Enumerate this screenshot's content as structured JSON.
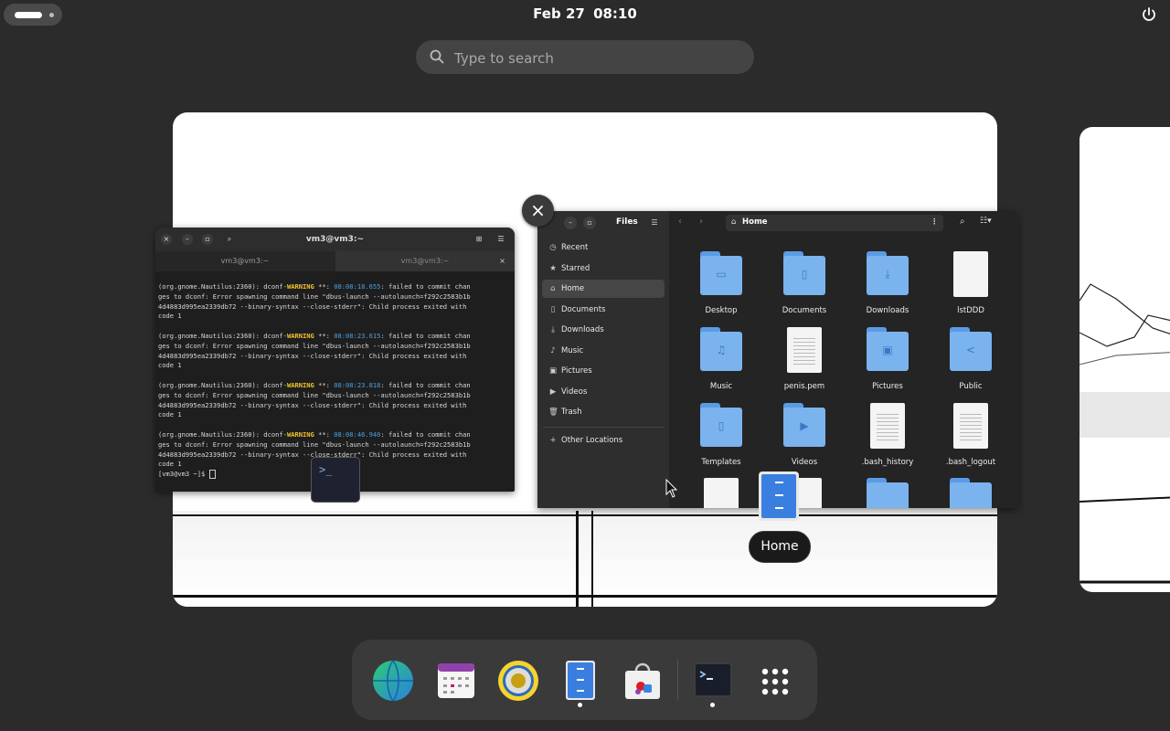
{
  "topbar": {
    "date": "Feb 27",
    "time": "08:10"
  },
  "search": {
    "placeholder": "Type to search"
  },
  "terminal": {
    "title": "vm3@vm3:~",
    "tabs": [
      "vm3@vm3:~",
      "vm3@vm3:~"
    ],
    "close_tab": "×",
    "log_entries": [
      {
        "prefix": "(org.gnome.Nautilus:2360): dconf-",
        "level": "WARNING",
        "mid": " **: ",
        "time": "08:08:18.655",
        "msg": ": failed to commit chan",
        "rest": [
          "ges to dconf: Error spawning command line \"dbus-launch --autolaunch=f292c2583b1b",
          "4d4883d995ea2339db72 --binary-syntax --close-stderr\": Child process exited with",
          "code 1"
        ]
      },
      {
        "prefix": "(org.gnome.Nautilus:2360): dconf-",
        "level": "WARNING",
        "mid": " **: ",
        "time": "08:08:23.615",
        "msg": ": failed to commit chan",
        "rest": [
          "ges to dconf: Error spawning command line \"dbus-launch --autolaunch=f292c2583b1b",
          "4d4883d995ea2339db72 --binary-syntax --close-stderr\": Child process exited with",
          "code 1"
        ]
      },
      {
        "prefix": "(org.gnome.Nautilus:2360): dconf-",
        "level": "WARNING",
        "mid": " **: ",
        "time": "08:08:23.818",
        "msg": ": failed to commit chan",
        "rest": [
          "ges to dconf: Error spawning command line \"dbus-launch --autolaunch=f292c2583b1b",
          "4d4883d995ea2339db72 --binary-syntax --close-stderr\": Child process exited with",
          "code 1"
        ]
      },
      {
        "prefix": "(org.gnome.Nautilus:2360): dconf-",
        "level": "WARNING",
        "mid": " **: ",
        "time": "08:08:46.940",
        "msg": ": failed to commit chan",
        "rest": [
          "ges to dconf: Error spawning command line \"dbus-launch --autolaunch=f292c2583b1b",
          "4d4883d995ea2339db72 --binary-syntax --close-stderr\": Child process exited with",
          "code 1"
        ]
      }
    ],
    "prompt": "[vm3@vm3 ~]$ "
  },
  "close_window": "×",
  "files": {
    "app_title": "Files",
    "location": "Home",
    "sidebar": [
      {
        "icon": "clock-icon",
        "label": "Recent"
      },
      {
        "icon": "star-icon",
        "label": "Starred"
      },
      {
        "icon": "home-icon",
        "label": "Home",
        "active": true
      },
      {
        "icon": "document-icon",
        "label": "Documents"
      },
      {
        "icon": "download-icon",
        "label": "Downloads"
      },
      {
        "icon": "music-icon",
        "label": "Music"
      },
      {
        "icon": "picture-icon",
        "label": "Pictures"
      },
      {
        "icon": "video-icon",
        "label": "Videos"
      },
      {
        "icon": "trash-icon",
        "label": "Trash"
      }
    ],
    "other_locations": "Other Locations",
    "items": [
      {
        "name": "Desktop",
        "kind": "folder",
        "glyph": "▭"
      },
      {
        "name": "Documents",
        "kind": "folder",
        "glyph": "▯"
      },
      {
        "name": "Downloads",
        "kind": "folder",
        "glyph": "⤓"
      },
      {
        "name": "lstDDD",
        "kind": "file"
      },
      {
        "name": "Music",
        "kind": "folder",
        "glyph": "♫"
      },
      {
        "name": "penis.pem",
        "kind": "doc"
      },
      {
        "name": "Pictures",
        "kind": "folder",
        "glyph": "▣"
      },
      {
        "name": "Public",
        "kind": "folder",
        "glyph": "<"
      },
      {
        "name": "Templates",
        "kind": "folder",
        "glyph": "▯"
      },
      {
        "name": "Videos",
        "kind": "folder",
        "glyph": "▶"
      },
      {
        "name": ".bash_history",
        "kind": "doc"
      },
      {
        "name": ".bash_logout",
        "kind": "doc"
      }
    ]
  },
  "drag_tooltip": "Home",
  "dock": {
    "apps": [
      {
        "name": "web-browser",
        "running": false
      },
      {
        "name": "calendar",
        "running": false
      },
      {
        "name": "rhythmbox-music",
        "running": false
      },
      {
        "name": "files",
        "running": true
      },
      {
        "name": "software-store",
        "running": false
      },
      {
        "name": "terminal",
        "running": true
      },
      {
        "name": "show-apps",
        "running": false
      }
    ]
  },
  "colors": {
    "accent_blue": "#3a7fe0",
    "folder_blue": "#7bb3ee",
    "warning_yellow": "#f2c12e",
    "timestamp_blue": "#4ca0e0"
  }
}
